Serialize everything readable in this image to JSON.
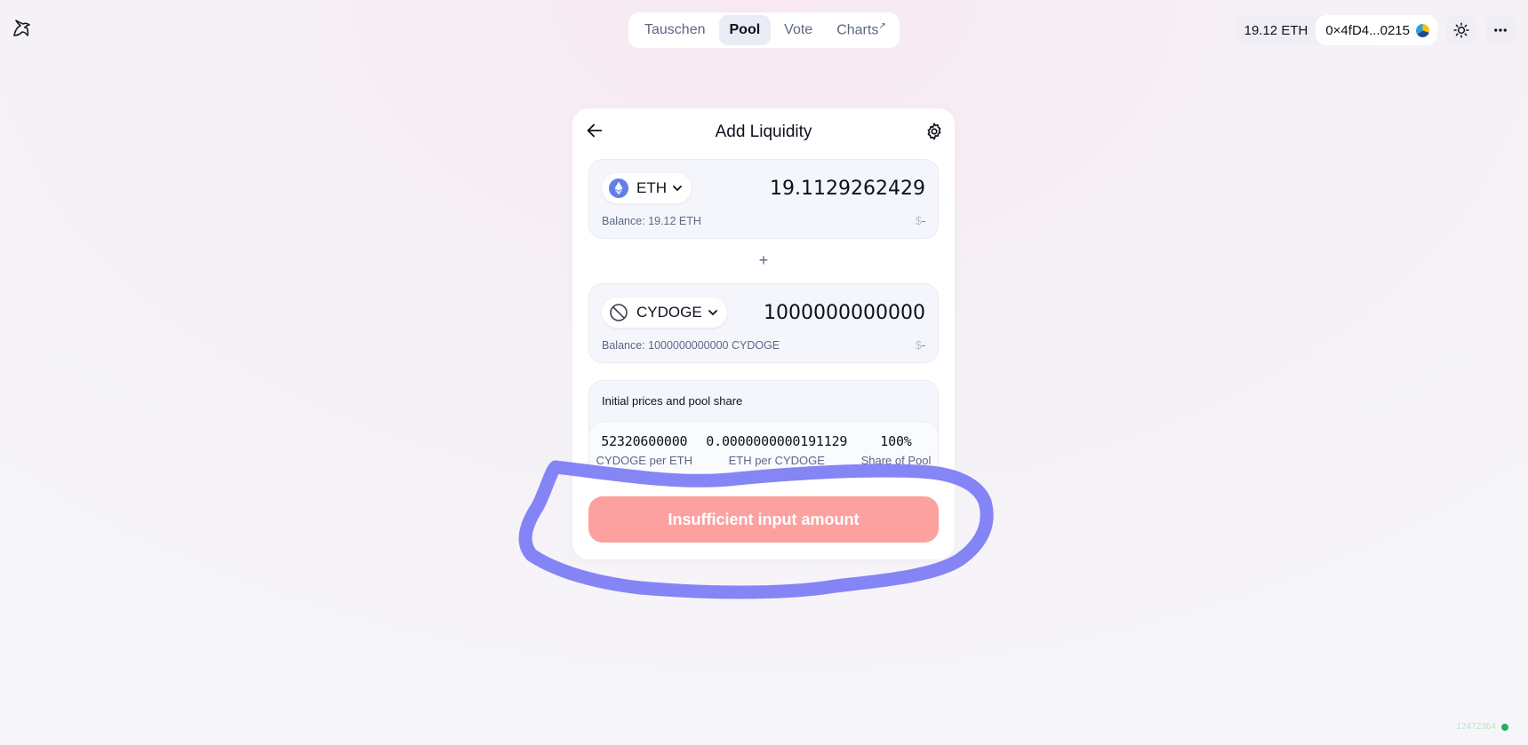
{
  "nav": {
    "items": [
      {
        "label": "Tauschen",
        "active": false
      },
      {
        "label": "Pool",
        "active": true
      },
      {
        "label": "Vote",
        "active": false
      },
      {
        "label": "Charts",
        "external_mark": "↗",
        "active": false
      }
    ]
  },
  "wallet": {
    "balance": "19.12 ETH",
    "address": "0×4fD4...0215"
  },
  "card": {
    "title": "Add Liquidity",
    "token_a": {
      "symbol": "ETH",
      "amount": "19.1129262429",
      "balance": "Balance: 19.12 ETH",
      "usd_sign": "$",
      "usd_value": "-"
    },
    "plus": "+",
    "token_b": {
      "symbol": "CYDOGE",
      "amount": "1000000000000",
      "balance": "Balance: 1000000000000 CYDOGE",
      "usd_sign": "$",
      "usd_value": "-"
    },
    "info": {
      "title": "Initial prices and pool share",
      "stats": [
        {
          "value": "52320600000",
          "label": "CYDOGE per ETH"
        },
        {
          "value": "0.0000000000191129",
          "label": "ETH per CYDOGE"
        },
        {
          "value": "100%",
          "label": "Share of Pool"
        }
      ]
    },
    "submit_label": "Insufficient input amount"
  },
  "block_number": "12472364",
  "colors": {
    "accent_pink": "#fca0a0",
    "annotation": "#7b7bf5",
    "eth_blue": "#627eea",
    "status_green": "#27ae60"
  }
}
